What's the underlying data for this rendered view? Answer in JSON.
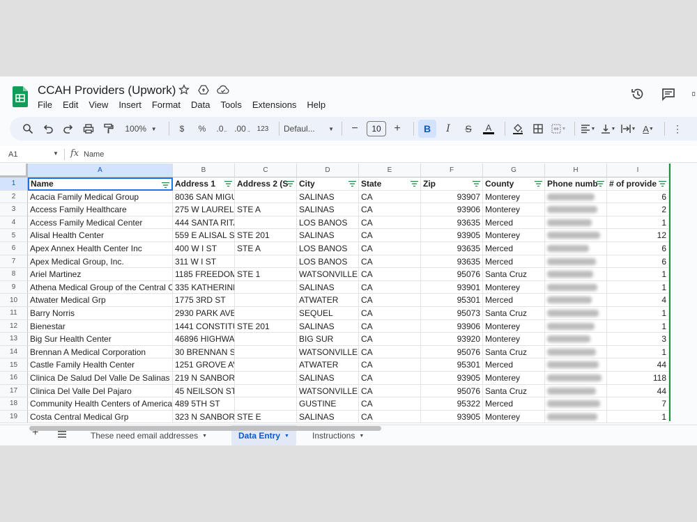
{
  "doc": {
    "title": "CCAH Providers (Upwork)"
  },
  "menu": [
    "File",
    "Edit",
    "View",
    "Insert",
    "Format",
    "Data",
    "Tools",
    "Extensions",
    "Help"
  ],
  "toolbar": {
    "zoom": "100%",
    "currency": "$",
    "percent": "%",
    "dec_dec": ".0",
    "inc_dec": ".00",
    "format_123": "123",
    "font": "Defaul...",
    "font_size": "10",
    "bold": "B",
    "italic": "I",
    "text_color": "A",
    "text_rotation": "A"
  },
  "formula": {
    "cell_ref": "A1",
    "fx": "fx",
    "value": "Name"
  },
  "columns": [
    "A",
    "B",
    "C",
    "D",
    "E",
    "F",
    "G",
    "H",
    "I"
  ],
  "headers": [
    "Name",
    "Address 1",
    "Address 2 (S",
    "City",
    "State",
    "Zip",
    "County",
    "Phone numb",
    "# of provide"
  ],
  "rows": [
    {
      "n": "2",
      "name": "Acacia Family Medical Group",
      "a1": "8036 SAN MIGU",
      "a2": "",
      "city": "SALINAS",
      "state": "CA",
      "zip": "93907",
      "county": "Monterey",
      "prov": "6"
    },
    {
      "n": "3",
      "name": "Access Family Healthcare",
      "a1": "275 W LAUREL",
      "a2": "STE A",
      "city": "SALINAS",
      "state": "CA",
      "zip": "93906",
      "county": "Monterey",
      "prov": "2"
    },
    {
      "n": "4",
      "name": "Access Family Medical Center",
      "a1": "444 SANTA RITA",
      "a2": "",
      "city": "LOS BANOS",
      "state": "CA",
      "zip": "93635",
      "county": "Merced",
      "prov": "1"
    },
    {
      "n": "5",
      "name": "Alisal Health Center",
      "a1": "559 E ALISAL S",
      "a2": "STE 201",
      "city": "SALINAS",
      "state": "CA",
      "zip": "93905",
      "county": "Monterey",
      "prov": "12"
    },
    {
      "n": "6",
      "name": "Apex Annex Health Center Inc",
      "a1": "400 W I ST",
      "a2": "STE A",
      "city": "LOS BANOS",
      "state": "CA",
      "zip": "93635",
      "county": "Merced",
      "prov": "6"
    },
    {
      "n": "7",
      "name": "Apex Medical Group, Inc.",
      "a1": "311 W I ST",
      "a2": "",
      "city": "LOS BANOS",
      "state": "CA",
      "zip": "93635",
      "county": "Merced",
      "prov": "6"
    },
    {
      "n": "8",
      "name": "Ariel Martinez",
      "a1": "1185 FREEDOM",
      "a2": "STE 1",
      "city": "WATSONVILLE",
      "state": "CA",
      "zip": "95076",
      "county": "Santa Cruz",
      "prov": "1"
    },
    {
      "n": "9",
      "name": "Athena Medical Group of the Central C",
      "a1": "335 KATHERINE",
      "a2": "",
      "city": "SALINAS",
      "state": "CA",
      "zip": "93901",
      "county": "Monterey",
      "prov": "1"
    },
    {
      "n": "10",
      "name": "Atwater Medical Grp",
      "a1": "1775 3RD ST",
      "a2": "",
      "city": "ATWATER",
      "state": "CA",
      "zip": "95301",
      "county": "Merced",
      "prov": "4"
    },
    {
      "n": "11",
      "name": "Barry Norris",
      "a1": "2930 PARK AVE",
      "a2": "",
      "city": "SEQUEL",
      "state": "CA",
      "zip": "95073",
      "county": "Santa Cruz",
      "prov": "1"
    },
    {
      "n": "12",
      "name": "Bienestar",
      "a1": "1441 CONSTITU",
      "a2": "STE 201",
      "city": "SALINAS",
      "state": "CA",
      "zip": "93906",
      "county": "Monterey",
      "prov": "1"
    },
    {
      "n": "13",
      "name": "Big Sur Health Center",
      "a1": "46896 HIGHWA",
      "a2": "",
      "city": "BIG SUR",
      "state": "CA",
      "zip": "93920",
      "county": "Monterey",
      "prov": "3"
    },
    {
      "n": "14",
      "name": "Brennan A Medical Corporation",
      "a1": "30 BRENNAN S",
      "a2": "",
      "city": "WATSONVILLE",
      "state": "CA",
      "zip": "95076",
      "county": "Santa Cruz",
      "prov": "1"
    },
    {
      "n": "15",
      "name": "Castle Family Health Center",
      "a1": "1251 GROVE AV",
      "a2": "",
      "city": "ATWATER",
      "state": "CA",
      "zip": "95301",
      "county": "Merced",
      "prov": "44"
    },
    {
      "n": "16",
      "name": "Clinica De Salud Del Valle De Salinas",
      "a1": "219 N SANBORI",
      "a2": "",
      "city": "SALINAS",
      "state": "CA",
      "zip": "93905",
      "county": "Monterey",
      "prov": "118"
    },
    {
      "n": "17",
      "name": "Clinica Del Valle Del Pajaro",
      "a1": "45 NEILSON ST",
      "a2": "",
      "city": "WATSONVILLE",
      "state": "CA",
      "zip": "95076",
      "county": "Santa Cruz",
      "prov": "44"
    },
    {
      "n": "18",
      "name": "Community Health Centers of America",
      "a1": "489 5TH ST",
      "a2": "",
      "city": "GUSTINE",
      "state": "CA",
      "zip": "95322",
      "county": "Merced",
      "prov": "7"
    },
    {
      "n": "19",
      "name": "Costa Central Medical Grp",
      "a1": "323 N SANBORI",
      "a2": "STE E",
      "city": "SALINAS",
      "state": "CA",
      "zip": "93905",
      "county": "Monterey",
      "prov": "1"
    }
  ],
  "sheet_tabs": [
    {
      "label": "These need email addresses",
      "active": false
    },
    {
      "label": "Data Entry",
      "active": true
    },
    {
      "label": "Instructions",
      "active": false
    }
  ]
}
